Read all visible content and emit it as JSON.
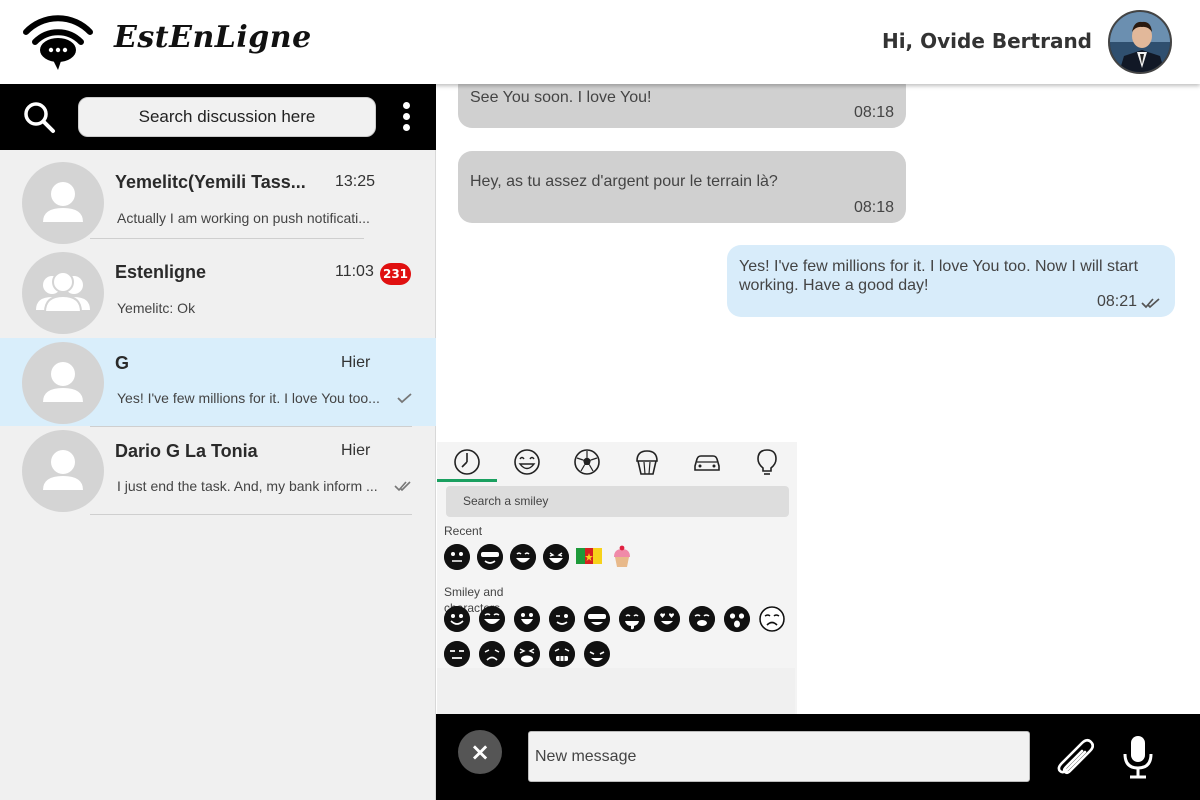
{
  "header": {
    "app_name": "EstEnLigne",
    "greeting": "Hi, Ovide Bertrand"
  },
  "sidebar": {
    "search_placeholder": "Search discussion here",
    "conversations": [
      {
        "name": "Yemelitc(Yemili Tass...",
        "time": "13:25",
        "preview": "Actually I am working on push notificati...",
        "badge": "",
        "selected": false,
        "read_ticks": "none"
      },
      {
        "name": "Estenligne",
        "time": "11:03",
        "preview": "Yemelitc: Ok",
        "badge": "231",
        "selected": false,
        "read_ticks": "none"
      },
      {
        "name": "G",
        "time": "Hier",
        "preview": "Yes! I've few millions for it. I love You too...",
        "badge": "",
        "selected": true,
        "read_ticks": "single"
      },
      {
        "name": "Dario G La Tonia",
        "time": "Hier",
        "preview": "I just end the task. And, my bank inform ...",
        "badge": "",
        "selected": false,
        "read_ticks": "double"
      }
    ]
  },
  "chat": {
    "messages": [
      {
        "direction": "in",
        "text": "See You soon. I love You!",
        "time": "08:18"
      },
      {
        "direction": "in",
        "text": "Hey, as tu assez d'argent pour le terrain là?",
        "time": "08:18"
      },
      {
        "direction": "out",
        "text": "Yes! I've few millions for it. I love You too. Now I will start working. Have a good day!",
        "time": "08:21",
        "read_ticks": "double"
      }
    ]
  },
  "emoji_picker": {
    "tabs": [
      "clock-icon",
      "smiley-icon",
      "soccer-ball-icon",
      "cupcake-icon",
      "car-icon",
      "lightbulb-icon"
    ],
    "active_tab": "clock-icon",
    "search_placeholder": "Search a smiley",
    "recent_label": "Recent",
    "smileys_label": "Smiley and characters"
  },
  "composer": {
    "placeholder": "New message",
    "close_label": "×"
  },
  "colors": {
    "accent_green": "#1aa060",
    "badge_red": "#e01010",
    "selected_row": "#d9eefb",
    "outgoing_bubble": "#d8ecfa",
    "incoming_bubble": "#d0d0d0"
  }
}
